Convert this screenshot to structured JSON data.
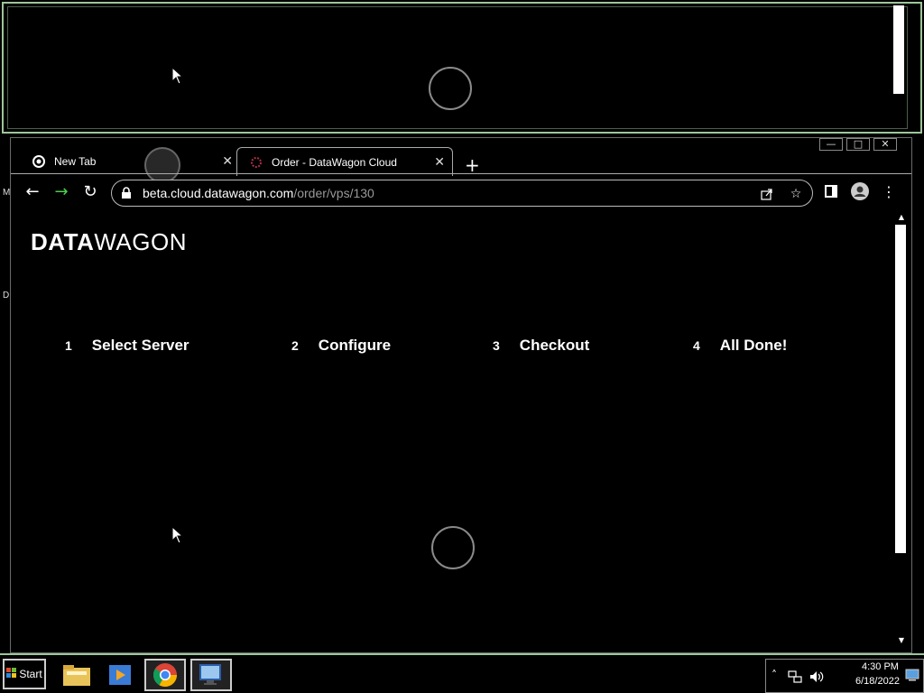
{
  "desktop": {
    "edge_letters": [
      "M",
      "D"
    ]
  },
  "browser": {
    "window_controls": {
      "minimize": "—",
      "maximize": "□",
      "close": "✕"
    },
    "tabs": [
      {
        "title": "New Tab",
        "icon": "chrome-icon",
        "active": false,
        "close": "✕"
      },
      {
        "title": "Order - DataWagon Cloud",
        "icon": "datawagon-favicon",
        "active": true,
        "close": "✕"
      }
    ],
    "new_tab": "+",
    "toolbar": {
      "back": "←",
      "forward": "→",
      "reload": "↻"
    },
    "omnibox": {
      "host": "beta.cloud.datawagon.com",
      "path": "/order/vps/130"
    },
    "icons": {
      "share": "share-icon",
      "bookmark": "☆",
      "side_panel": "side-panel-icon",
      "profile": "profile-icon",
      "menu": "⋮"
    }
  },
  "page": {
    "logo": {
      "bold": "DATA",
      "light": "WAGON"
    },
    "steps": [
      {
        "number": "1",
        "label": "Select Server"
      },
      {
        "number": "2",
        "label": "Configure"
      },
      {
        "number": "3",
        "label": "Checkout"
      },
      {
        "number": "4",
        "label": "All Done!"
      }
    ]
  },
  "taskbar": {
    "start_label": "Start",
    "apps": [
      "file-explorer-icon",
      "media-player-icon",
      "chrome-icon",
      "remote-desktop-icon"
    ],
    "tray": {
      "expand": "˄",
      "network": "network-icon",
      "volume": "volume-icon"
    },
    "clock": {
      "time": "4:30 PM",
      "date": "6/18/2022"
    }
  }
}
